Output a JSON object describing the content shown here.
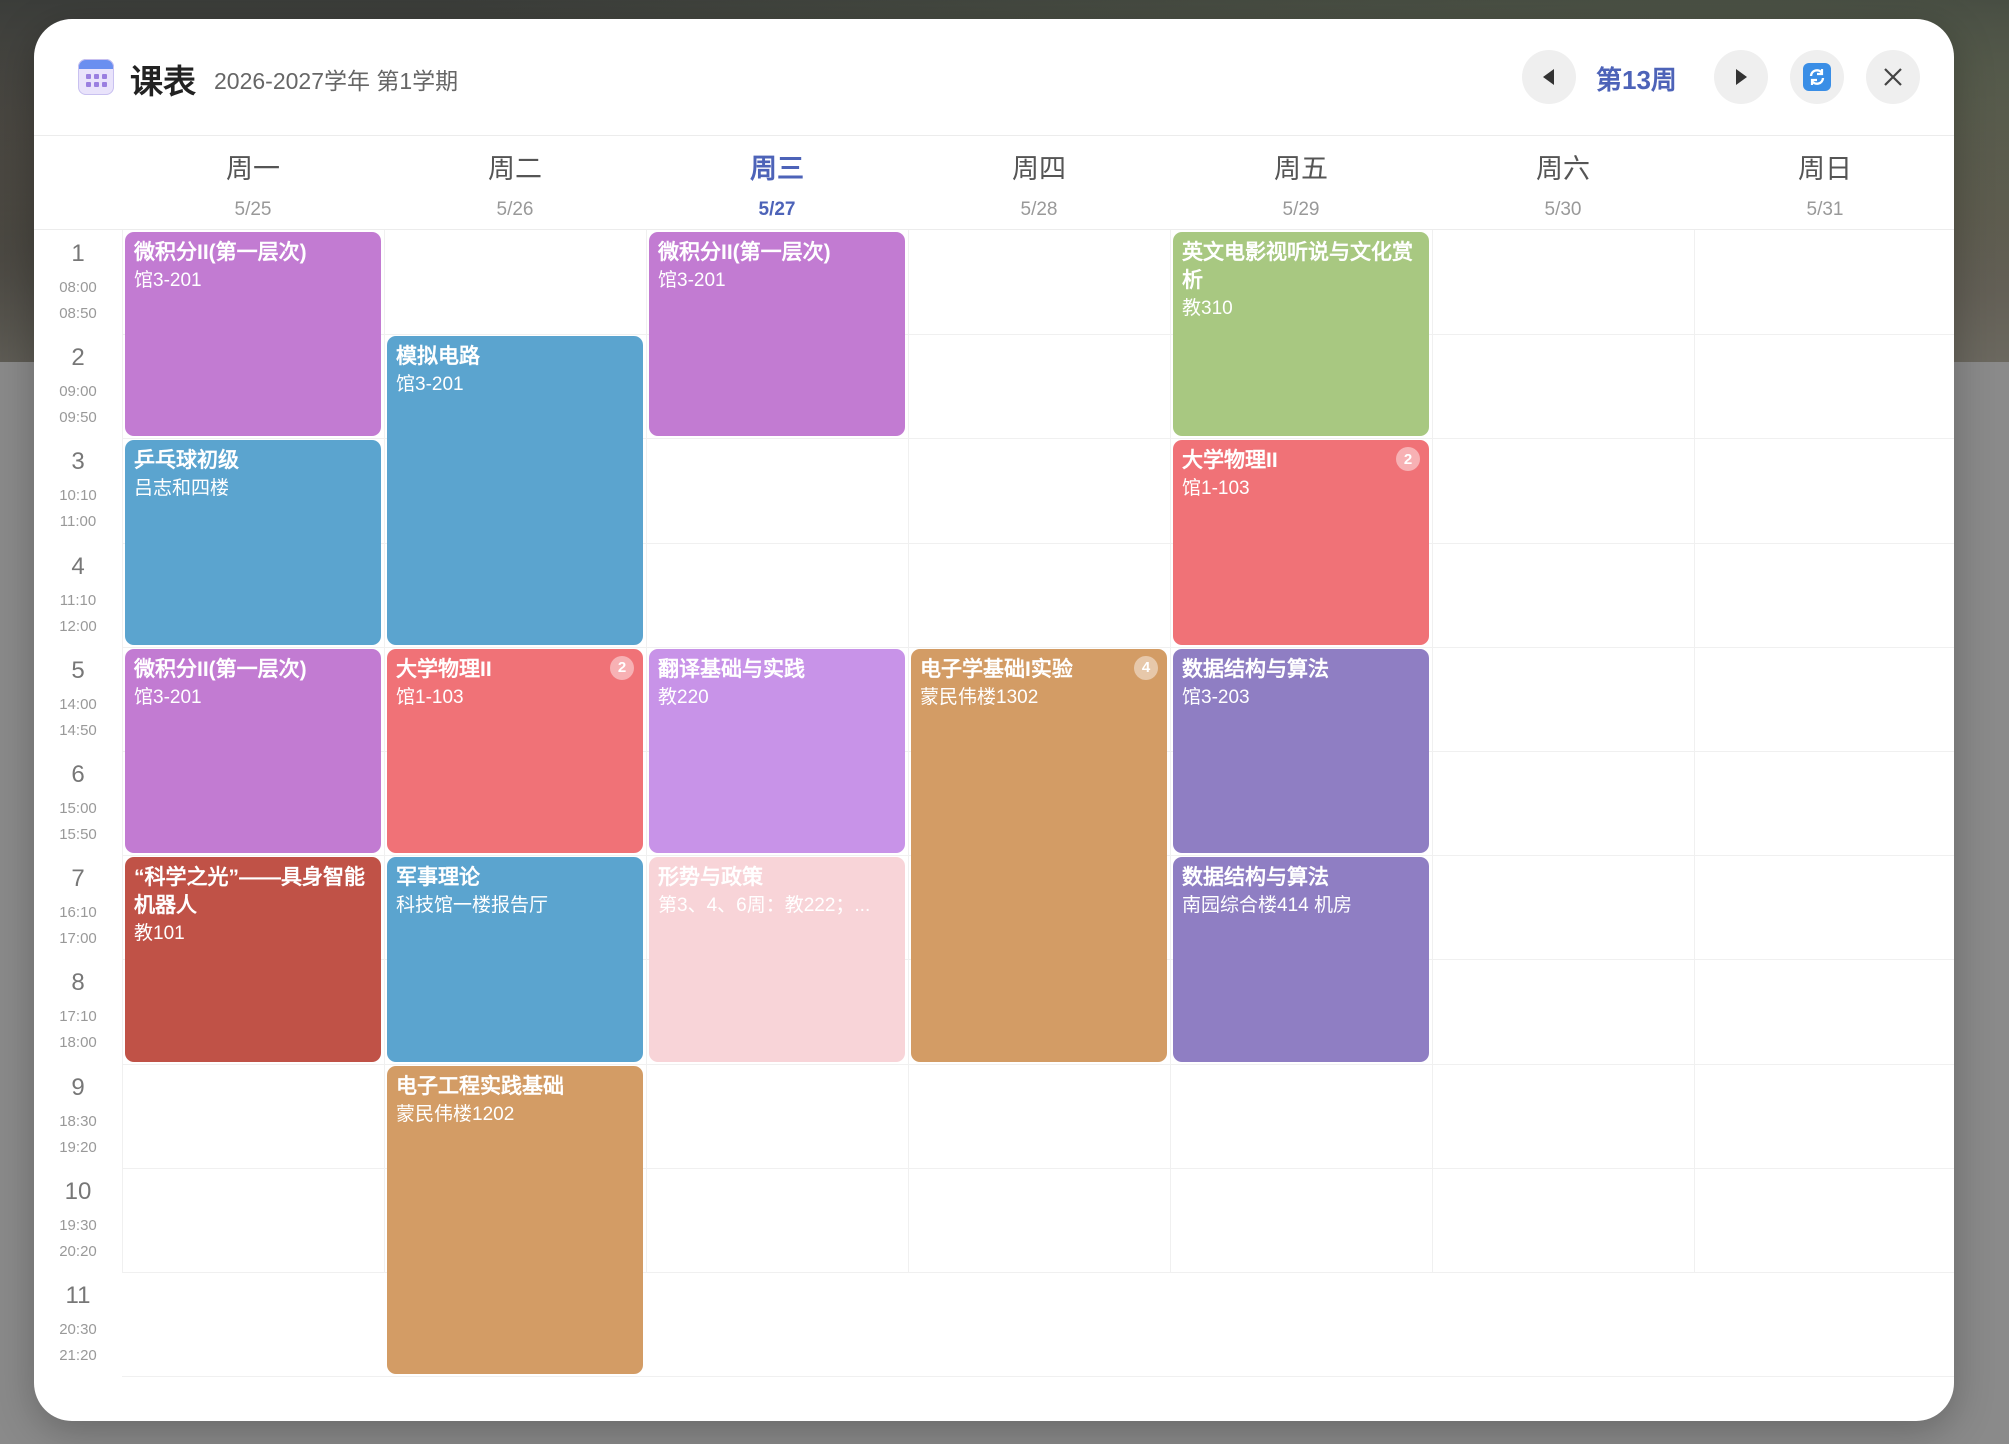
{
  "header": {
    "title": "课表",
    "term": "2026-2027学年 第1学期",
    "week_label": "第13周",
    "icons": [
      "calendar-icon",
      "prev-week-icon",
      "next-week-icon",
      "refresh-icon",
      "close-icon"
    ]
  },
  "days": [
    {
      "name": "周一",
      "date": "5/25"
    },
    {
      "name": "周二",
      "date": "5/26"
    },
    {
      "name": "周三",
      "date": "5/27",
      "today": true
    },
    {
      "name": "周四",
      "date": "5/28"
    },
    {
      "name": "周五",
      "date": "5/29"
    },
    {
      "name": "周六",
      "date": "5/30"
    },
    {
      "name": "周日",
      "date": "5/31"
    }
  ],
  "periods": [
    {
      "n": "1",
      "start": "08:00",
      "end": "08:50"
    },
    {
      "n": "2",
      "start": "09:00",
      "end": "09:50"
    },
    {
      "n": "3",
      "start": "10:10",
      "end": "11:00"
    },
    {
      "n": "4",
      "start": "11:10",
      "end": "12:00"
    },
    {
      "n": "5",
      "start": "14:00",
      "end": "14:50"
    },
    {
      "n": "6",
      "start": "15:00",
      "end": "15:50"
    },
    {
      "n": "7",
      "start": "16:10",
      "end": "17:00"
    },
    {
      "n": "8",
      "start": "17:10",
      "end": "18:00"
    },
    {
      "n": "9",
      "start": "18:30",
      "end": "19:20"
    },
    {
      "n": "10",
      "start": "19:30",
      "end": "20:20"
    },
    {
      "n": "11",
      "start": "20:30",
      "end": "21:20"
    }
  ],
  "courses": [
    {
      "name": "微积分II(第一层次)",
      "room": "馆3-201",
      "day": 1,
      "from": 1,
      "to": 2,
      "color": "purple"
    },
    {
      "name": "乒乓球初级",
      "room": "吕志和四楼",
      "day": 1,
      "from": 3,
      "to": 4,
      "color": "blue"
    },
    {
      "name": "微积分II(第一层次)",
      "room": "馆3-201",
      "day": 1,
      "from": 5,
      "to": 6,
      "color": "purple"
    },
    {
      "name": "“科学之光”——具身智能机器人",
      "room": "教101",
      "day": 1,
      "from": 7,
      "to": 8,
      "color": "brick"
    },
    {
      "name": "模拟电路",
      "room": "馆3-201",
      "day": 2,
      "from": 2,
      "to": 4,
      "color": "blue"
    },
    {
      "name": "大学物理II",
      "room": "馆1-103",
      "day": 2,
      "from": 5,
      "to": 6,
      "color": "red",
      "badge": "2"
    },
    {
      "name": "军事理论",
      "room": "科技馆一楼报告厅",
      "day": 2,
      "from": 7,
      "to": 8,
      "color": "blue"
    },
    {
      "name": "电子工程实践基础",
      "room": "蒙民伟楼1202",
      "day": 2,
      "from": 9,
      "to": 11,
      "color": "orange"
    },
    {
      "name": "微积分II(第一层次)",
      "room": "馆3-201",
      "day": 3,
      "from": 1,
      "to": 2,
      "color": "purple"
    },
    {
      "name": "翻译基础与实践",
      "room": "教220",
      "day": 3,
      "from": 5,
      "to": 6,
      "color": "lilac"
    },
    {
      "name": "形势与政策",
      "room": "第3、4、6周：教222；...",
      "day": 3,
      "from": 7,
      "to": 8,
      "color": "pink"
    },
    {
      "name": "电子学基础I实验",
      "room": "蒙民伟楼1302",
      "day": 4,
      "from": 5,
      "to": 8,
      "color": "orange",
      "badge": "4"
    },
    {
      "name": "英文电影视听说与文化赏析",
      "room": "教310",
      "day": 5,
      "from": 1,
      "to": 2,
      "color": "green"
    },
    {
      "name": "大学物理II",
      "room": "馆1-103",
      "day": 5,
      "from": 3,
      "to": 4,
      "color": "red",
      "badge": "2"
    },
    {
      "name": "数据结构与算法",
      "room": "馆3-203",
      "day": 5,
      "from": 5,
      "to": 6,
      "color": "violet"
    },
    {
      "name": "数据结构与算法",
      "room": "南园综合楼414 机房",
      "day": 5,
      "from": 7,
      "to": 8,
      "color": "violet"
    }
  ]
}
